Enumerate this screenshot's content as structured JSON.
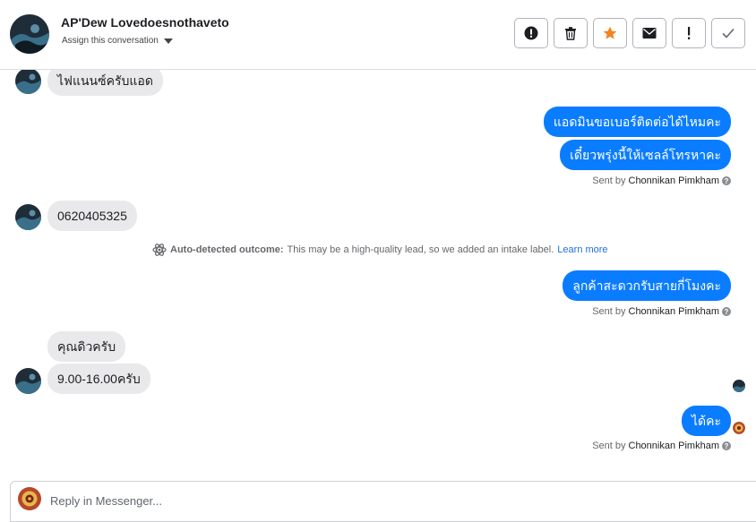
{
  "header": {
    "contact_name": "AP'Dew Lovedoesnothaveto",
    "assign_label": "Assign this conversation",
    "actions": [
      "report-icon",
      "trash-icon",
      "star-icon",
      "envelope-icon",
      "exclamation-icon",
      "check-icon"
    ],
    "star_color": "#f5821f"
  },
  "thread": {
    "messages": [
      {
        "from": "contact",
        "text": "ไฟแนนซ์ครับแอด"
      },
      {
        "from": "page",
        "text": "แอดมินขอเบอร์ติดต่อได้ไหมคะ"
      },
      {
        "from": "page",
        "text": "เดี๋ยวพรุ่งนี้ให้เซลล์โทรหาคะ"
      },
      {
        "from": "contact",
        "text": "0620405325"
      },
      {
        "from": "page",
        "text": "ลูกค้าสะดวกรับสายกี่โมงคะ"
      },
      {
        "from": "contact",
        "text": "คุณดิวครับ"
      },
      {
        "from": "contact",
        "text": "9.00-16.00ครับ"
      },
      {
        "from": "page",
        "text": "ได้คะ"
      }
    ],
    "sent_by_prefix": "Sent by",
    "sent_by_name": "Chonnikan Pimkham",
    "notice": {
      "title": "Auto-detected outcome:",
      "text": "This may be a high-quality lead, so we added an intake label.",
      "link": "Learn more"
    }
  },
  "reply": {
    "placeholder": "Reply in Messenger..."
  },
  "colors": {
    "outgoing_bubble": "#0a7cff",
    "incoming_bubble": "#e9e9eb",
    "link": "#216fdb"
  }
}
